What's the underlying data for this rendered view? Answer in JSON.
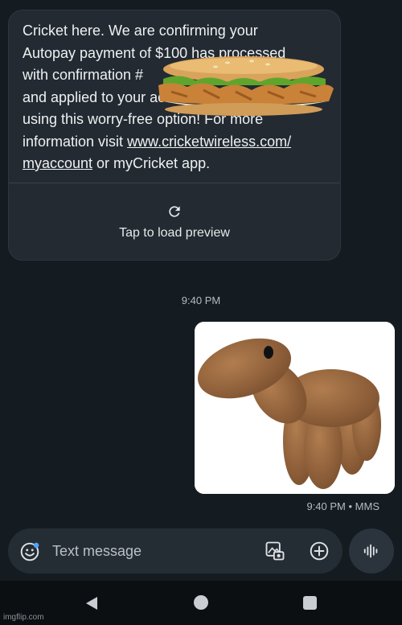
{
  "incoming_message": {
    "lines": [
      "Cricket here. We are confirming your",
      "Autopay payment of $100 has processed",
      "with confirmation #",
      "and applied to your account. Thank you for",
      "using this worry-free option! For more",
      "information visit"
    ],
    "link_part1": "www.cricketwireless.com/",
    "link_part2": "myaccount",
    "tail": " or myCricket app.",
    "preview_label": "Tap to load preview"
  },
  "conversation": {
    "timestamp": "9:40 PM",
    "sent_meta": "9:40 PM • MMS"
  },
  "composer": {
    "placeholder": "Text message"
  },
  "watermark": "imgflip.com",
  "colors": {
    "background": "#141b21",
    "incoming_bubble": "#232a31",
    "composer": "#252d34"
  },
  "icons": {
    "refresh": "refresh-icon",
    "emoji": "emoji-icon",
    "gallery": "gallery-icon",
    "add": "add-icon",
    "voice": "voice-icon"
  }
}
